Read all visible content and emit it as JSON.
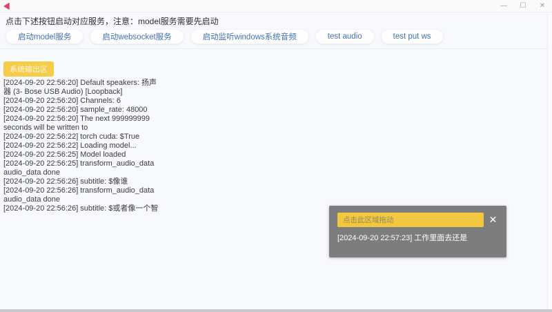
{
  "window": {
    "controls": {
      "minimize": "—",
      "maximize": "☐",
      "close": "✕"
    }
  },
  "header": {
    "instruction": "点击下述按钮启动对应服务，注意：model服务需要先启动"
  },
  "toolbar": {
    "buttons": [
      {
        "label": "启动model服务"
      },
      {
        "label": "启动websocket服务"
      },
      {
        "label": "启动监听windows系统音频"
      },
      {
        "label": "test audio"
      },
      {
        "label": "test put ws"
      }
    ]
  },
  "output": {
    "section_label": "系统输出区",
    "lines": [
      "[2024-09-20 22:56:20] Default speakers: 扬声",
      "器 (3- Bose USB Audio) [Loopback]",
      "[2024-09-20 22:56:20] Channels: 6",
      "[2024-09-20 22:56:20] sample_rate: 48000",
      "[2024-09-20 22:56:20] The next 999999999",
      "seconds will be written to",
      "[2024-09-20 22:56:22] torch cuda: $True",
      "[2024-09-20 22:56:22] Loading model...",
      "[2024-09-20 22:56:25] Model loaded",
      "[2024-09-20 22:56:25] transform_audio_data",
      "audio_data done",
      "[2024-09-20 22:56:26] subtitle: $像谁",
      "[2024-09-20 22:56:26] transform_audio_data",
      "audio_data done",
      "[2024-09-20 22:56:26] subtitle: $或者像一个智"
    ]
  },
  "subtitle_panel": {
    "drag_handle_label": "点击此区域拖动",
    "close_label": "✕",
    "message": "[2024-09-20 22:57:23] 工作里面去还是"
  },
  "colors": {
    "accent_yellow": "#f6cd4b",
    "button_text_blue": "#4272b0",
    "panel_gray": "#7d7d7d",
    "app_icon_pink": "#d5486b"
  }
}
